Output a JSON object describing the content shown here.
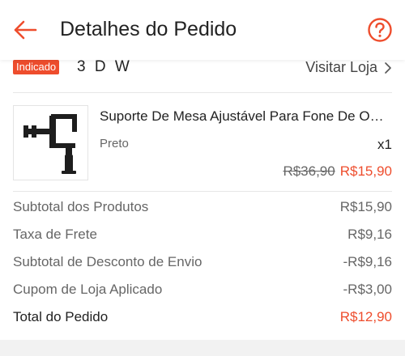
{
  "header": {
    "title": "Detalhes do Pedido",
    "back_icon": "back-arrow-icon",
    "help_icon": "help-question-icon",
    "accent_color": "#ee4d2d"
  },
  "shop": {
    "badge": "Indicado",
    "name": "3 D W",
    "visit_label": "Visitar Loja",
    "chevron_icon": "chevron-right-icon"
  },
  "product": {
    "name": "Suporte De Mesa Ajustável Para Fone De Ouvido",
    "variant": "Preto",
    "quantity": "x1",
    "original_price": "R$36,90",
    "price": "R$15,90"
  },
  "summary": {
    "rows": [
      {
        "label": "Subtotal dos Produtos",
        "value": "R$15,90"
      },
      {
        "label": "Taxa de Frete",
        "value": "R$9,16"
      },
      {
        "label": "Subtotal de Desconto de Envio",
        "value": "-R$9,16"
      },
      {
        "label": "Cupom de Loja Aplicado",
        "value": "-R$3,00"
      }
    ],
    "total": {
      "label": "Total do Pedido",
      "value": "R$12,90"
    }
  }
}
